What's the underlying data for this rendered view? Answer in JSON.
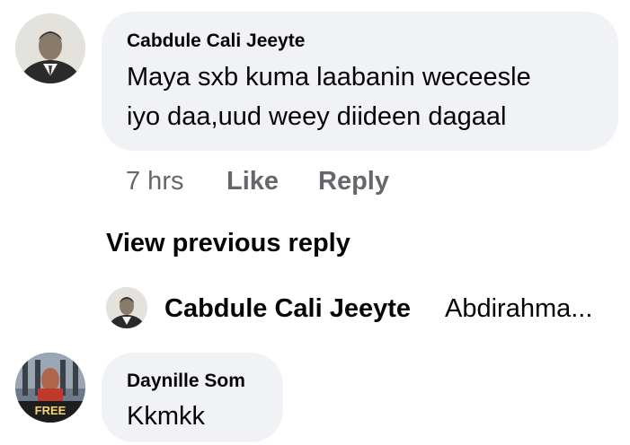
{
  "comments": [
    {
      "author": "Cabdule Cali Jeeyte",
      "text_line1": "Maya sxb kuma laabanin weceesle",
      "text_line2": "iyo daa,uud weey diideen dagaal",
      "time": "7 hrs",
      "like_label": "Like",
      "reply_label": "Reply",
      "avatar_icon": "portrait-photo-icon"
    },
    {
      "author": "Daynille Som",
      "text": "Kkmkk",
      "avatar_icon": "free-badge-photo-icon",
      "avatar_badge": "FREE"
    }
  ],
  "view_previous_reply": "View previous reply",
  "reply_preview": {
    "author": "Cabdule Cali Jeeyte",
    "snippet": "Abdirahma..."
  }
}
